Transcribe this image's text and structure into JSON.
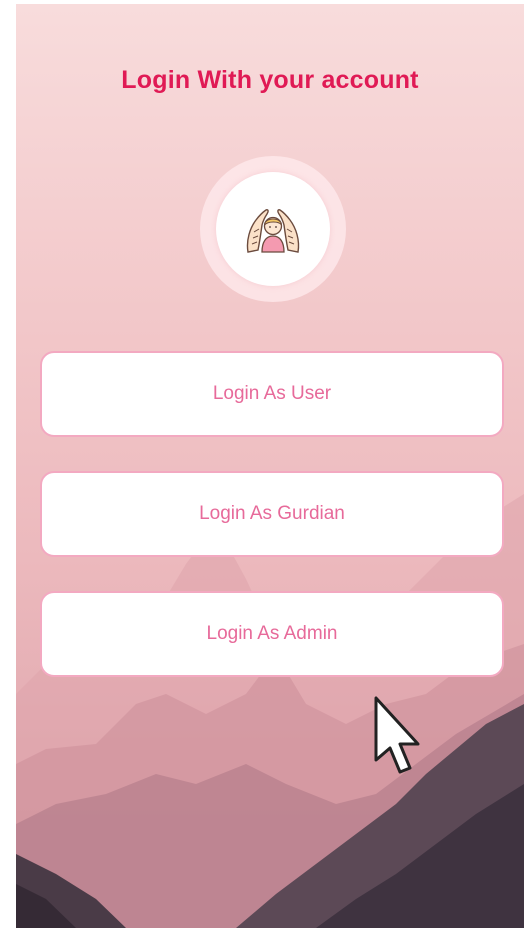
{
  "screen": {
    "title": "Login With your account"
  },
  "logo": {
    "icon": "protective-hands-child-icon"
  },
  "buttons": {
    "user": "Login As User",
    "guardian": "Login As Gurdian",
    "admin": "Login As Admin"
  },
  "colors": {
    "title": "#e01a55",
    "button_text": "#e76a9a",
    "button_border": "#f3a9c1",
    "background_top": "#f8dcdc",
    "background_bottom": "#d7a0a8"
  }
}
